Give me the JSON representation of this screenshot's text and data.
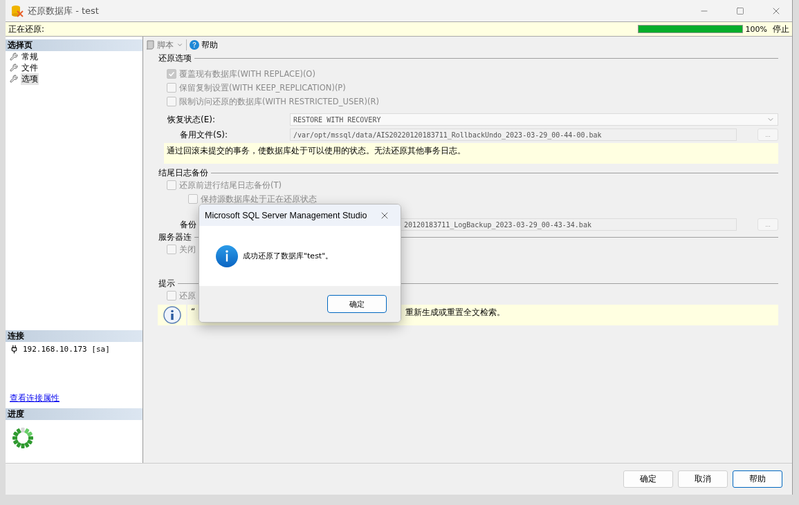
{
  "window": {
    "title": "还原数据库 - test"
  },
  "status_strip": {
    "label": "正在还原:",
    "progress": {
      "level": 1,
      "reading": "100%"
    },
    "stop": "停止"
  },
  "sidebar": {
    "pages_header": "选择页",
    "pages": [
      {
        "label": "常规",
        "selected": false
      },
      {
        "label": "文件",
        "selected": false
      },
      {
        "label": "选项",
        "selected": true
      }
    ],
    "connection_header": "连接",
    "connection": "192.168.10.173 [sa]",
    "connection_link": "查看连接属性",
    "progress_header": "进度"
  },
  "toolbar": {
    "script": "脚本",
    "help": "帮助"
  },
  "restore_options": {
    "title": "还原选项",
    "checkboxes": [
      {
        "label": "覆盖现有数据库(WITH REPLACE)(O)",
        "checked": true,
        "disabled": true
      },
      {
        "label": "保留复制设置(WITH KEEP_REPLICATION)(P)",
        "checked": false,
        "disabled": true
      },
      {
        "label": "限制访问还原的数据库(WITH RESTRICTED_USER)(R)",
        "checked": false,
        "disabled": true
      }
    ],
    "recovery_state": {
      "label": "恢复状态(E):",
      "value": "RESTORE WITH RECOVERY"
    },
    "standby_file": {
      "label": "备用文件(S):",
      "value": "/var/opt/mssql/data/AIS20220120183711_RollbackUndo_2023-03-29_00-44-00.bak",
      "browse": "..."
    },
    "description": "通过回滚未提交的事务，使数据库处于可以使用的状态。无法还原其他事务日志。"
  },
  "tail_log_backup": {
    "title": "结尾日志备份",
    "checkboxes": [
      {
        "label": "还原前进行结尾日志备份(T)",
        "checked": false,
        "disabled": true,
        "children": [
          {
            "label": "保持源数据库处于正在还原状态",
            "checked": false,
            "disabled": true
          }
        ]
      }
    ],
    "backup_file": {
      "label": "备份",
      "value": "20120183711_LogBackup_2023-03-29_00-43-34.bak",
      "browse": "..."
    }
  },
  "server_connections": {
    "title": "服务器连",
    "checkboxes": [
      {
        "label": "关闭",
        "checked": false,
        "disabled": true
      }
    ]
  },
  "tips": {
    "title": "提示",
    "checkboxes": [
      {
        "label": "还原",
        "checked": false,
        "disabled": true
      }
    ],
    "tip": {
      "start": "“",
      "end": "重新生成或重置全文检索。"
    }
  },
  "buttons": [
    {
      "label": "确定",
      "selected": false
    },
    {
      "label": "取消",
      "selected": false
    },
    {
      "label": "帮助",
      "selected": true
    }
  ],
  "dialog": {
    "title": "Microsoft SQL Server Management Studio",
    "message": "成功还原了数据库\"test\"。",
    "button": "确定"
  }
}
